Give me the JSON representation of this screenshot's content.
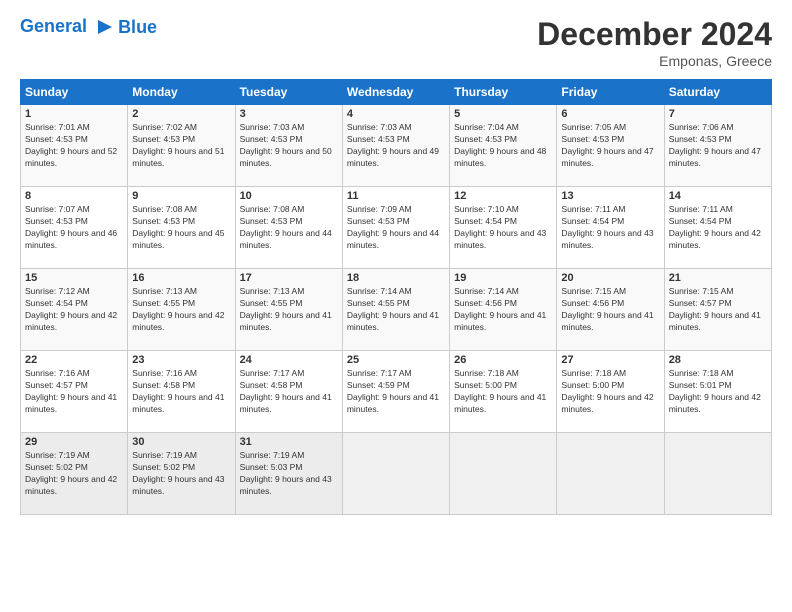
{
  "header": {
    "logo_line1": "General",
    "logo_line2": "Blue",
    "month_title": "December 2024",
    "location": "Emponas, Greece"
  },
  "weekdays": [
    "Sunday",
    "Monday",
    "Tuesday",
    "Wednesday",
    "Thursday",
    "Friday",
    "Saturday"
  ],
  "weeks": [
    [
      {
        "day": "1",
        "sunrise": "Sunrise: 7:01 AM",
        "sunset": "Sunset: 4:53 PM",
        "daylight": "Daylight: 9 hours and 52 minutes."
      },
      {
        "day": "2",
        "sunrise": "Sunrise: 7:02 AM",
        "sunset": "Sunset: 4:53 PM",
        "daylight": "Daylight: 9 hours and 51 minutes."
      },
      {
        "day": "3",
        "sunrise": "Sunrise: 7:03 AM",
        "sunset": "Sunset: 4:53 PM",
        "daylight": "Daylight: 9 hours and 50 minutes."
      },
      {
        "day": "4",
        "sunrise": "Sunrise: 7:03 AM",
        "sunset": "Sunset: 4:53 PM",
        "daylight": "Daylight: 9 hours and 49 minutes."
      },
      {
        "day": "5",
        "sunrise": "Sunrise: 7:04 AM",
        "sunset": "Sunset: 4:53 PM",
        "daylight": "Daylight: 9 hours and 48 minutes."
      },
      {
        "day": "6",
        "sunrise": "Sunrise: 7:05 AM",
        "sunset": "Sunset: 4:53 PM",
        "daylight": "Daylight: 9 hours and 47 minutes."
      },
      {
        "day": "7",
        "sunrise": "Sunrise: 7:06 AM",
        "sunset": "Sunset: 4:53 PM",
        "daylight": "Daylight: 9 hours and 47 minutes."
      }
    ],
    [
      {
        "day": "8",
        "sunrise": "Sunrise: 7:07 AM",
        "sunset": "Sunset: 4:53 PM",
        "daylight": "Daylight: 9 hours and 46 minutes."
      },
      {
        "day": "9",
        "sunrise": "Sunrise: 7:08 AM",
        "sunset": "Sunset: 4:53 PM",
        "daylight": "Daylight: 9 hours and 45 minutes."
      },
      {
        "day": "10",
        "sunrise": "Sunrise: 7:08 AM",
        "sunset": "Sunset: 4:53 PM",
        "daylight": "Daylight: 9 hours and 44 minutes."
      },
      {
        "day": "11",
        "sunrise": "Sunrise: 7:09 AM",
        "sunset": "Sunset: 4:53 PM",
        "daylight": "Daylight: 9 hours and 44 minutes."
      },
      {
        "day": "12",
        "sunrise": "Sunrise: 7:10 AM",
        "sunset": "Sunset: 4:54 PM",
        "daylight": "Daylight: 9 hours and 43 minutes."
      },
      {
        "day": "13",
        "sunrise": "Sunrise: 7:11 AM",
        "sunset": "Sunset: 4:54 PM",
        "daylight": "Daylight: 9 hours and 43 minutes."
      },
      {
        "day": "14",
        "sunrise": "Sunrise: 7:11 AM",
        "sunset": "Sunset: 4:54 PM",
        "daylight": "Daylight: 9 hours and 42 minutes."
      }
    ],
    [
      {
        "day": "15",
        "sunrise": "Sunrise: 7:12 AM",
        "sunset": "Sunset: 4:54 PM",
        "daylight": "Daylight: 9 hours and 42 minutes."
      },
      {
        "day": "16",
        "sunrise": "Sunrise: 7:13 AM",
        "sunset": "Sunset: 4:55 PM",
        "daylight": "Daylight: 9 hours and 42 minutes."
      },
      {
        "day": "17",
        "sunrise": "Sunrise: 7:13 AM",
        "sunset": "Sunset: 4:55 PM",
        "daylight": "Daylight: 9 hours and 41 minutes."
      },
      {
        "day": "18",
        "sunrise": "Sunrise: 7:14 AM",
        "sunset": "Sunset: 4:55 PM",
        "daylight": "Daylight: 9 hours and 41 minutes."
      },
      {
        "day": "19",
        "sunrise": "Sunrise: 7:14 AM",
        "sunset": "Sunset: 4:56 PM",
        "daylight": "Daylight: 9 hours and 41 minutes."
      },
      {
        "day": "20",
        "sunrise": "Sunrise: 7:15 AM",
        "sunset": "Sunset: 4:56 PM",
        "daylight": "Daylight: 9 hours and 41 minutes."
      },
      {
        "day": "21",
        "sunrise": "Sunrise: 7:15 AM",
        "sunset": "Sunset: 4:57 PM",
        "daylight": "Daylight: 9 hours and 41 minutes."
      }
    ],
    [
      {
        "day": "22",
        "sunrise": "Sunrise: 7:16 AM",
        "sunset": "Sunset: 4:57 PM",
        "daylight": "Daylight: 9 hours and 41 minutes."
      },
      {
        "day": "23",
        "sunrise": "Sunrise: 7:16 AM",
        "sunset": "Sunset: 4:58 PM",
        "daylight": "Daylight: 9 hours and 41 minutes."
      },
      {
        "day": "24",
        "sunrise": "Sunrise: 7:17 AM",
        "sunset": "Sunset: 4:58 PM",
        "daylight": "Daylight: 9 hours and 41 minutes."
      },
      {
        "day": "25",
        "sunrise": "Sunrise: 7:17 AM",
        "sunset": "Sunset: 4:59 PM",
        "daylight": "Daylight: 9 hours and 41 minutes."
      },
      {
        "day": "26",
        "sunrise": "Sunrise: 7:18 AM",
        "sunset": "Sunset: 5:00 PM",
        "daylight": "Daylight: 9 hours and 41 minutes."
      },
      {
        "day": "27",
        "sunrise": "Sunrise: 7:18 AM",
        "sunset": "Sunset: 5:00 PM",
        "daylight": "Daylight: 9 hours and 42 minutes."
      },
      {
        "day": "28",
        "sunrise": "Sunrise: 7:18 AM",
        "sunset": "Sunset: 5:01 PM",
        "daylight": "Daylight: 9 hours and 42 minutes."
      }
    ],
    [
      {
        "day": "29",
        "sunrise": "Sunrise: 7:19 AM",
        "sunset": "Sunset: 5:02 PM",
        "daylight": "Daylight: 9 hours and 42 minutes."
      },
      {
        "day": "30",
        "sunrise": "Sunrise: 7:19 AM",
        "sunset": "Sunset: 5:02 PM",
        "daylight": "Daylight: 9 hours and 43 minutes."
      },
      {
        "day": "31",
        "sunrise": "Sunrise: 7:19 AM",
        "sunset": "Sunset: 5:03 PM",
        "daylight": "Daylight: 9 hours and 43 minutes."
      },
      null,
      null,
      null,
      null
    ]
  ]
}
